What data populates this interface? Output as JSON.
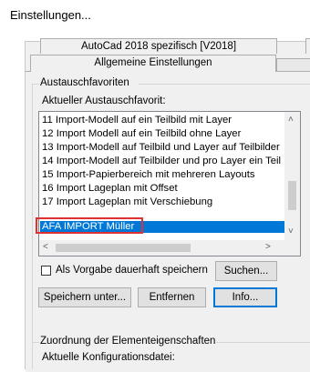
{
  "header": {
    "title": "Einstellungen..."
  },
  "tabs": {
    "back": "AutoCad 2018 spezifisch [V2018]",
    "front": "Allgemeine Einstellungen"
  },
  "favorites": {
    "group_title": "Austauschfavoriten",
    "current_label": "Aktueller Austauschfavorit:",
    "items": [
      "11 Import-Modell auf ein Teilbild mit Layer",
      "12 Import Modell auf ein Teilbild ohne Layer",
      "13 Import-Modell auf Teilbild und Layer auf Teilbilder",
      "14 Import-Modell auf Teilbilder und pro Layer ein Teil",
      "15 Import-Papierbereich mit mehreren Layouts",
      "16 Import Lageplan mit Offset",
      "17 Import Lageplan mit Verschiebung",
      "AFA IMPORT Müller"
    ],
    "selected_index": 7,
    "checkbox_label": "Als Vorgabe dauerhaft speichern",
    "checkbox_checked": false,
    "buttons": {
      "search": "Suchen...",
      "save_as": "Speichern unter...",
      "remove": "Entfernen",
      "info": "Info..."
    }
  },
  "assignment": {
    "group_title": "Zuordnung der Elementeigenschaften",
    "current_config_label": "Aktuelle Konfigurationsdatei:"
  }
}
